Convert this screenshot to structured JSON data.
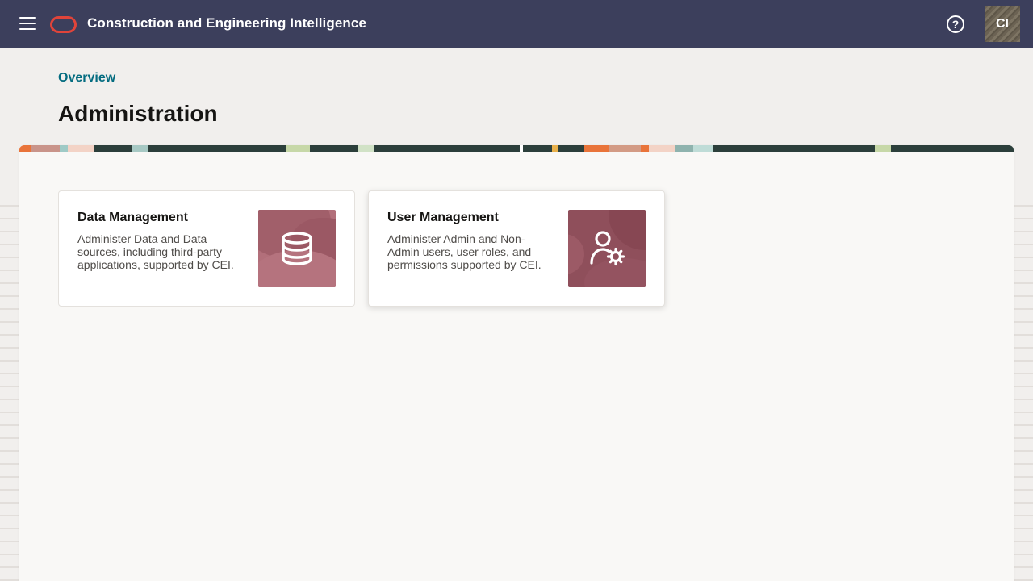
{
  "header": {
    "app_title": "Construction and Engineering Intelligence",
    "help_symbol": "?",
    "avatar_initials": "CI",
    "background_color": "#3c3f5c",
    "logo_color": "#e0443a"
  },
  "breadcrumb": {
    "label": "Overview"
  },
  "page": {
    "title": "Administration"
  },
  "cards": [
    {
      "title": "Data Management",
      "description": "Administer Data and Data sources, including third-party applications, supported by CEI.",
      "icon": "database-icon",
      "image_color": "#b26f7a"
    },
    {
      "title": "User Management",
      "description": "Administer Admin and Non-Admin users, user roles, and permissions supported by CEI.",
      "icon": "user-settings-icon",
      "image_color": "#8f4f5b"
    }
  ],
  "colors": {
    "link": "#046c80",
    "page_background": "#f1efed",
    "panel_background": "#f9f8f6"
  }
}
